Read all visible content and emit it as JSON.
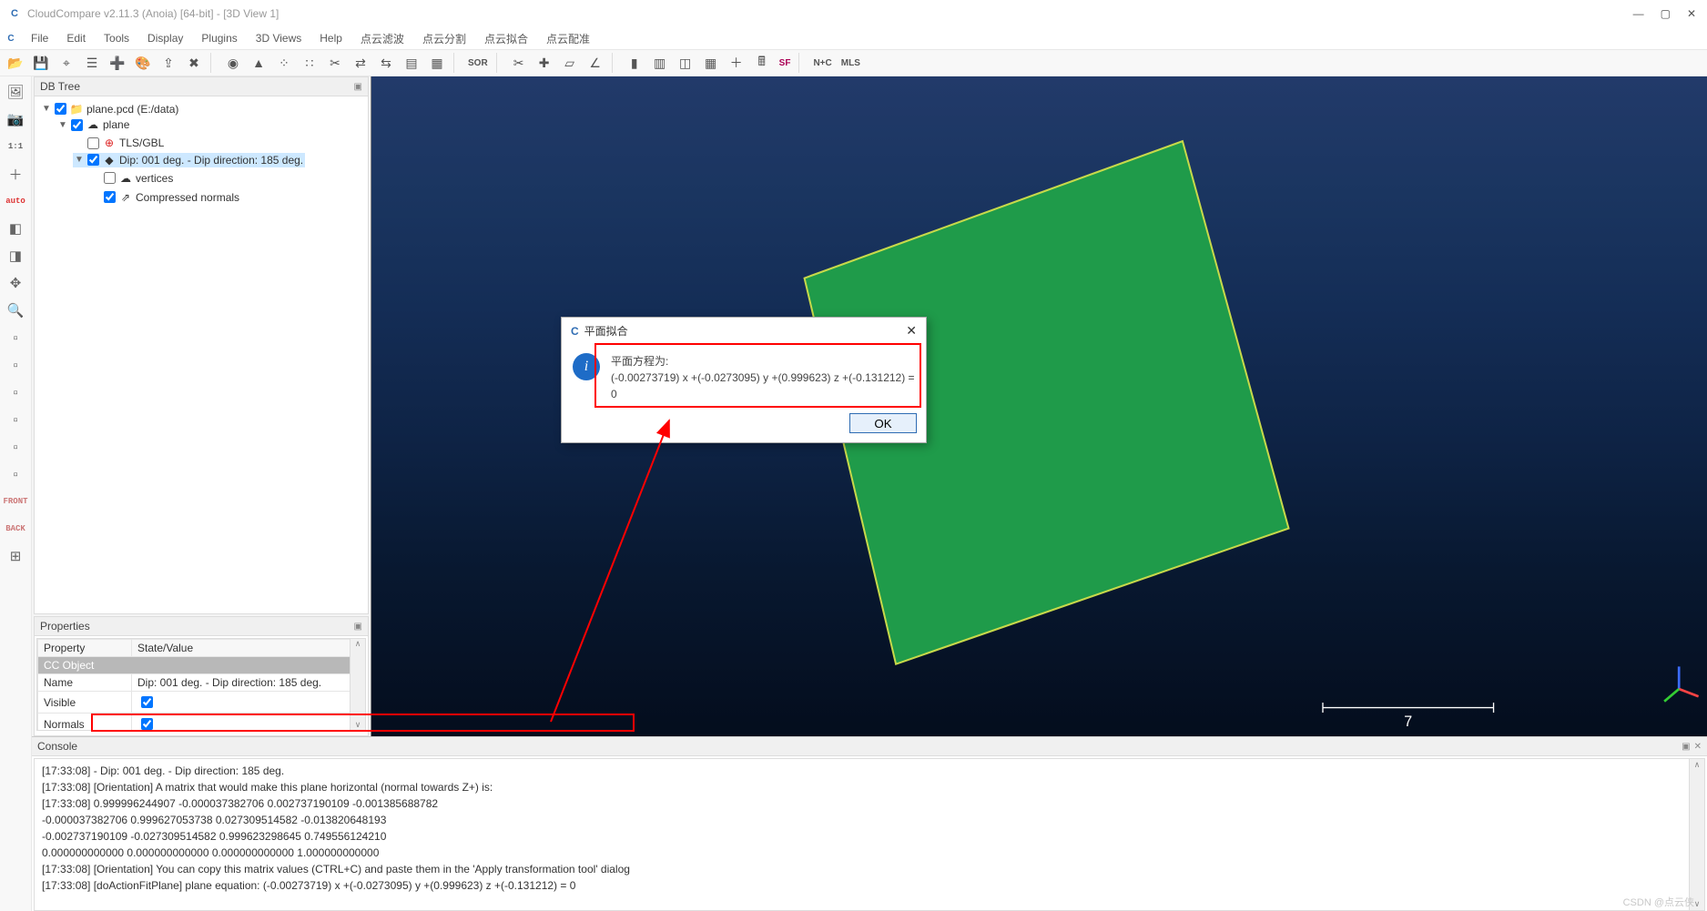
{
  "window": {
    "title": "CloudCompare v2.11.3 (Anoia) [64-bit] - [3D View 1]"
  },
  "menu": {
    "items": [
      "File",
      "Edit",
      "Tools",
      "Display",
      "Plugins",
      "3D Views",
      "Help",
      "点云滤波",
      "点云分割",
      "点云拟合",
      "点云配准"
    ]
  },
  "toolbar_main": [
    "open-file-icon",
    "save-icon",
    "point-picker-icon",
    "list-icon",
    "add-entity-icon",
    "colors-icon",
    "export-icon",
    "delete-icon",
    "sep",
    "clone-icon",
    "mesh-icon",
    "subsample-icon",
    "sample-points-icon",
    "segment-icon",
    "align-icon",
    "register-icon",
    "section-icon",
    "rasterize-icon",
    "sep",
    "sor-icon",
    "sep",
    "pcv-icon",
    "cross-icon",
    "plane-icon",
    "ransac-icon",
    "sep",
    "histogram-icon",
    "stats-icon",
    "scalar-icon",
    "grid-icon",
    "plus-icon",
    "calc-icon",
    "sf-icon",
    "sep",
    "nc-icon",
    "mls-icon"
  ],
  "toolbar_main_labels": {
    "sor-icon": "SOR",
    "sf-icon": "SF",
    "nc-icon": "N+C",
    "mls-icon": "MLS"
  },
  "left_strip": [
    {
      "name": "view-image-icon",
      "glyph": "🖼"
    },
    {
      "name": "camera-icon",
      "glyph": "📷"
    },
    {
      "name": "one-to-one-icon",
      "text": "1:1"
    },
    {
      "name": "plus-small-icon",
      "glyph": "＋"
    },
    {
      "name": "auto-icon",
      "text": "auto",
      "color": "#d33"
    },
    {
      "name": "cube-iso-front-icon",
      "glyph": "◧"
    },
    {
      "name": "cube-iso-right-icon",
      "glyph": "◨"
    },
    {
      "name": "translate-icon",
      "glyph": "✥"
    },
    {
      "name": "zoom-icon",
      "glyph": "🔍"
    },
    {
      "name": "view-top-icon",
      "glyph": "▫"
    },
    {
      "name": "view-front-icon",
      "glyph": "▫"
    },
    {
      "name": "view-left-icon",
      "glyph": "▫"
    },
    {
      "name": "view-back-icon",
      "glyph": "▫"
    },
    {
      "name": "view-right-icon",
      "glyph": "▫"
    },
    {
      "name": "view-bottom-icon",
      "glyph": "▫"
    },
    {
      "name": "view-cube-front-icon",
      "text": "FRONT",
      "color": "#c77"
    },
    {
      "name": "view-cube-back-icon",
      "text": "BACK",
      "color": "#c77"
    },
    {
      "name": "grid-icon",
      "glyph": "⊞"
    }
  ],
  "db_tree": {
    "title": "DB Tree",
    "root": {
      "label": "plane.pcd (E:/data)",
      "children": [
        {
          "label": "plane",
          "children": [
            {
              "label": "TLS/GBL",
              "checked": false,
              "icon": "target-icon"
            },
            {
              "label": "Dip: 001 deg. - Dip direction: 185 deg.",
              "checked": true,
              "selected": true,
              "icon": "plane-small-icon",
              "children": [
                {
                  "label": "vertices",
                  "checked": false,
                  "icon": "cloud-icon"
                },
                {
                  "label": "Compressed normals",
                  "checked": true,
                  "icon": "normals-icon"
                }
              ]
            }
          ]
        }
      ]
    }
  },
  "properties": {
    "title": "Properties",
    "headers": [
      "Property",
      "State/Value"
    ],
    "section": "CC Object",
    "rows": [
      {
        "k": "Name",
        "v": "Dip: 001 deg. - Dip direction: 185 deg."
      },
      {
        "k": "Visible",
        "check": true
      },
      {
        "k": "Normals",
        "check": true
      }
    ]
  },
  "dialog": {
    "title": "平面拟合",
    "line1": "平面方程为:",
    "line2": "(-0.00273719) x +(-0.0273095) y +(0.999623) z +(-0.131212) = 0",
    "ok": "OK"
  },
  "viewport": {
    "scale_label": "7"
  },
  "console": {
    "title": "Console",
    "lines": [
      "[17:33:08]  - Dip: 001 deg. - Dip direction: 185 deg.",
      "[17:33:08] [Orientation] A matrix that would make this plane horizontal (normal towards Z+) is:",
      "[17:33:08] 0.999996244907 -0.000037382706 0.002737190109 -0.001385688782",
      "-0.000037382706 0.999627053738 0.027309514582 -0.013820648193",
      "-0.002737190109 -0.027309514582 0.999623298645 0.749556124210",
      "0.000000000000 0.000000000000 0.000000000000 1.000000000000",
      "[17:33:08] [Orientation] You can copy this matrix values (CTRL+C) and paste them in the 'Apply transformation tool' dialog",
      "[17:33:08] [doActionFitPlane] plane equation: (-0.00273719) x +(-0.0273095) y +(0.999623) z +(-0.131212) = 0"
    ]
  },
  "watermark": "CSDN @点云侠"
}
